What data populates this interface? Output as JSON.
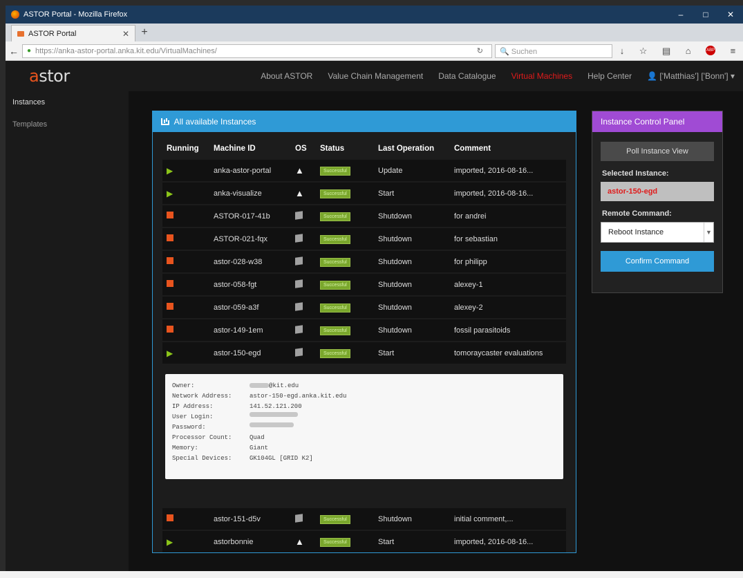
{
  "window": {
    "title": "ASTOR Portal - Mozilla Firefox"
  },
  "browser": {
    "tab_label": "ASTOR Portal",
    "url": "https://anka-astor-portal.anka.kit.edu/VirtualMachines/",
    "search_placeholder": "Suchen"
  },
  "app": {
    "logo": {
      "part1": "a",
      "part2": "stor"
    },
    "nav": {
      "about": "About ASTOR",
      "value_chain": "Value Chain Management",
      "data_catalogue": "Data Catalogue",
      "virtual_machines": "Virtual Machines",
      "help": "Help Center",
      "user": "['Matthias'] ['Bonn']"
    },
    "sidebar": {
      "instances": "Instances",
      "templates": "Templates"
    },
    "accent": "#2f9ad6",
    "active_color": "#e01b1b"
  },
  "instances_panel": {
    "title": "All available Instances",
    "headers": {
      "running": "Running",
      "machine_id": "Machine ID",
      "os": "OS",
      "status": "Status",
      "last_operation": "Last Operation",
      "comment": "Comment"
    },
    "rows": [
      {
        "running": true,
        "machine_id": "anka-astor-portal",
        "os": "linux",
        "status": "Successful",
        "last_operation": "Update",
        "comment": "imported, 2016-08-16..."
      },
      {
        "running": true,
        "machine_id": "anka-visualize",
        "os": "linux",
        "status": "Successful",
        "last_operation": "Start",
        "comment": "imported, 2016-08-16..."
      },
      {
        "running": false,
        "machine_id": "ASTOR-017-41b",
        "os": "windows",
        "status": "Successful",
        "last_operation": "Shutdown",
        "comment": "for andrei"
      },
      {
        "running": false,
        "machine_id": "ASTOR-021-fqx",
        "os": "windows",
        "status": "Successful",
        "last_operation": "Shutdown",
        "comment": "for sebastian"
      },
      {
        "running": false,
        "machine_id": "astor-028-w38",
        "os": "windows",
        "status": "Successful",
        "last_operation": "Shutdown",
        "comment": "for philipp"
      },
      {
        "running": false,
        "machine_id": "astor-058-fgt",
        "os": "windows",
        "status": "Successful",
        "last_operation": "Shutdown",
        "comment": "alexey-1"
      },
      {
        "running": false,
        "machine_id": "astor-059-a3f",
        "os": "windows",
        "status": "Successful",
        "last_operation": "Shutdown",
        "comment": "alexey-2"
      },
      {
        "running": false,
        "machine_id": "astor-149-1em",
        "os": "windows",
        "status": "Successful",
        "last_operation": "Shutdown",
        "comment": "fossil parasitoids"
      },
      {
        "running": true,
        "machine_id": "astor-150-egd",
        "os": "windows",
        "status": "Successful",
        "last_operation": "Start",
        "comment": "tomoraycaster evaluations"
      }
    ],
    "rows_after": [
      {
        "running": false,
        "machine_id": "astor-151-d5v",
        "os": "windows",
        "status": "Successful",
        "last_operation": "Shutdown",
        "comment": "initial comment,..."
      },
      {
        "running": true,
        "machine_id": "astorbonnie",
        "os": "linux",
        "status": "Successful",
        "last_operation": "Start",
        "comment": "imported, 2016-08-16..."
      }
    ],
    "details": {
      "owner_label": "Owner:",
      "owner_value": "@kit.edu",
      "network_label": "Network Address:",
      "network_value": "astor-150-egd.anka.kit.edu",
      "ip_label": "IP Address:",
      "ip_value": "141.52.121.200",
      "login_label": "User Login:",
      "password_label": "Password:",
      "cpu_label": "Processor Count:",
      "cpu_value": "Quad",
      "memory_label": "Memory:",
      "memory_value": "Giant",
      "devices_label": "Special Devices:",
      "devices_value": "GK104GL [GRID K2]"
    }
  },
  "control_panel": {
    "title": "Instance Control Panel",
    "poll_button": "Poll Instance View",
    "selected_label": "Selected Instance:",
    "selected_value": "astor-150-egd",
    "remote_label": "Remote Command:",
    "remote_value": "Reboot Instance",
    "confirm_button": "Confirm Command"
  }
}
